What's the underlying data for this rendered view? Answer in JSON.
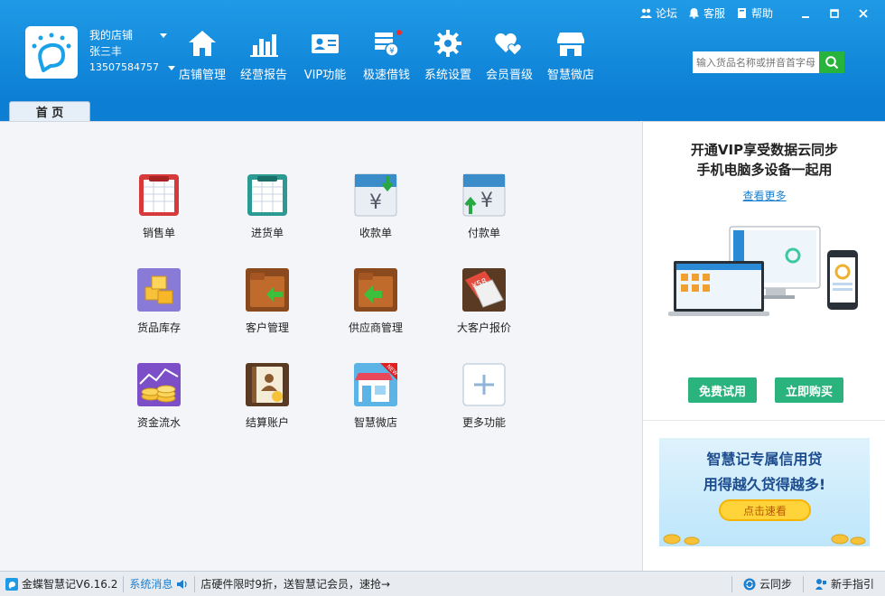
{
  "header": {
    "store_name": "我的店铺",
    "user_name": "张三丰",
    "phone": "13507584757",
    "nav": [
      {
        "label": "店铺管理",
        "icon": "shop-home-icon"
      },
      {
        "label": "经营报告",
        "icon": "bar-chart-icon"
      },
      {
        "label": "VIP功能",
        "icon": "vip-card-icon"
      },
      {
        "label": "极速借钱",
        "icon": "money-stack-icon"
      },
      {
        "label": "系统设置",
        "icon": "gear-icon"
      },
      {
        "label": "会员晋级",
        "icon": "hearts-icon"
      },
      {
        "label": "智慧微店",
        "icon": "storefront-icon"
      }
    ],
    "links": {
      "forum": "论坛",
      "service": "客服",
      "help": "帮助"
    },
    "search_placeholder": "输入货品名称或拼音首字母"
  },
  "tabs": {
    "home": "首 页"
  },
  "functions": [
    {
      "label": "销售单",
      "icon": "sales-order-icon"
    },
    {
      "label": "进货单",
      "icon": "purchase-order-icon"
    },
    {
      "label": "收款单",
      "icon": "receipt-icon"
    },
    {
      "label": "付款单",
      "icon": "payment-icon"
    },
    {
      "label": "货品库存",
      "icon": "inventory-icon"
    },
    {
      "label": "客户管理",
      "icon": "customer-folder-icon"
    },
    {
      "label": "供应商管理",
      "icon": "supplier-folder-icon"
    },
    {
      "label": "大客户报价",
      "icon": "price-tag-icon"
    },
    {
      "label": "资金流水",
      "icon": "coins-icon"
    },
    {
      "label": "结算账户",
      "icon": "account-book-icon"
    },
    {
      "label": "智慧微店",
      "icon": "micro-store-icon"
    },
    {
      "label": "更多功能",
      "icon": "plus-icon"
    }
  ],
  "promo": {
    "title_line1": "开通VIP享受数据云同步",
    "title_line2": "手机电脑多设备一起用",
    "more_link": "查看更多",
    "trial_button": "免费试用",
    "buy_button": "立即购买"
  },
  "banner": {
    "line1": "智慧记专属信用贷",
    "line2": "用得越久贷得越多!",
    "button": "点击速看"
  },
  "status": {
    "version": "金蝶智慧记V6.16.2",
    "system_msg": "系统消息",
    "ticker": "店硬件限时9折，送智慧记会员，速抢→",
    "cloud_sync": "云同步",
    "guide": "新手指引"
  },
  "colors": {
    "header_blue": "#1f9ae6",
    "accent_green": "#2bb37e",
    "link_blue": "#1a7fd0"
  }
}
